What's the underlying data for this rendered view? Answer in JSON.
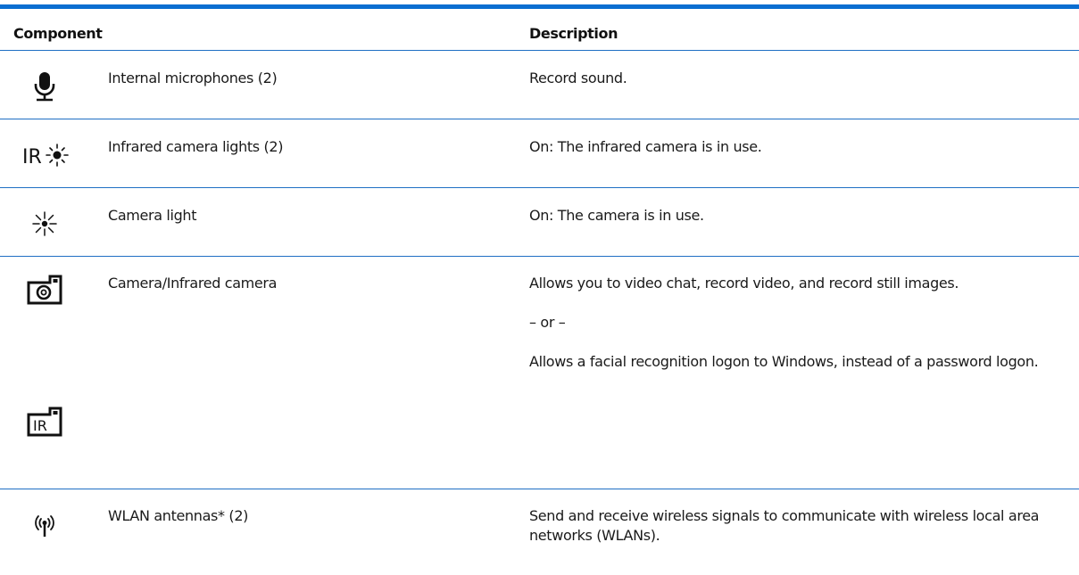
{
  "table": {
    "headers": {
      "component": "Component",
      "description": "Description"
    },
    "rows": [
      {
        "icon": "microphone-icon",
        "component": "Internal microphones (2)",
        "description": [
          "Record sound."
        ]
      },
      {
        "icon": "infrared-light-icon",
        "icon_text": "IR",
        "component": "Infrared camera lights (2)",
        "description": [
          "On: The infrared camera is in use."
        ]
      },
      {
        "icon": "camera-light-icon",
        "component": "Camera light",
        "description": [
          "On: The camera is in use."
        ]
      },
      {
        "icon": "camera-icon",
        "icon_secondary": "infrared-camera-icon",
        "icon_secondary_text": "IR",
        "component": "Camera/Infrared camera",
        "description": [
          "Allows you to video chat, record video, and record still images.",
          "– or –",
          "Allows a facial recognition logon to Windows, instead of a password logon."
        ]
      },
      {
        "icon": "wlan-antenna-icon",
        "component": "WLAN antennas* (2)",
        "description": [
          "Send and receive wireless signals to communicate with wireless local area networks (WLANs)."
        ]
      }
    ]
  },
  "colors": {
    "rule": "#0a6ed1",
    "row_divider": "#1f6fc4",
    "text": "#1a1a1a"
  }
}
